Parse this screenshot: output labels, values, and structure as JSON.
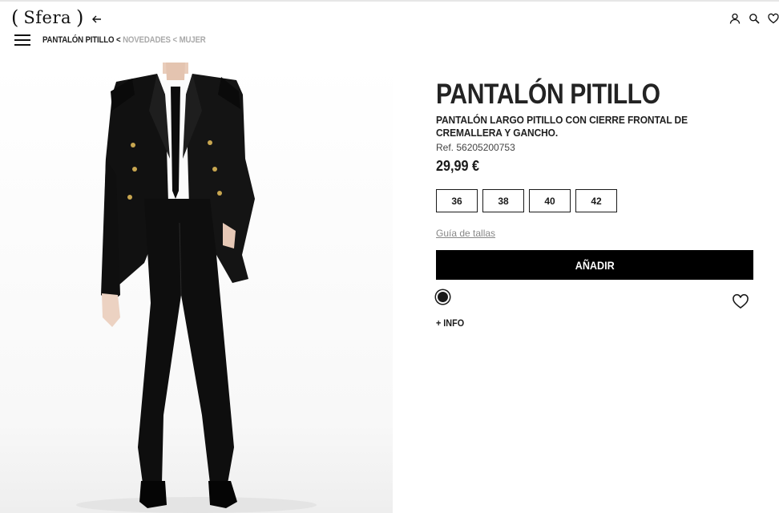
{
  "header": {
    "logo_text": "Sfera",
    "breadcrumb": {
      "current": "PANTALÓN PITILLO",
      "separator": "<",
      "crumbs": [
        "NOVEDADES",
        "MUJER"
      ]
    },
    "icons": [
      "user-icon",
      "search-icon",
      "heart-icon"
    ]
  },
  "product": {
    "title": "PANTALÓN PITILLO",
    "description": "PANTALÓN LARGO PITILLO CON CIERRE FRONTAL DE CREMALLERA Y GANCHO.",
    "ref": "Ref. 56205200753",
    "price": "29,99 €",
    "sizes": [
      "36",
      "38",
      "40",
      "42"
    ],
    "size_guide": "Guía de tallas",
    "add_button": "AÑADIR",
    "color": "#1a1a1a",
    "more_info": "+ INFO"
  }
}
